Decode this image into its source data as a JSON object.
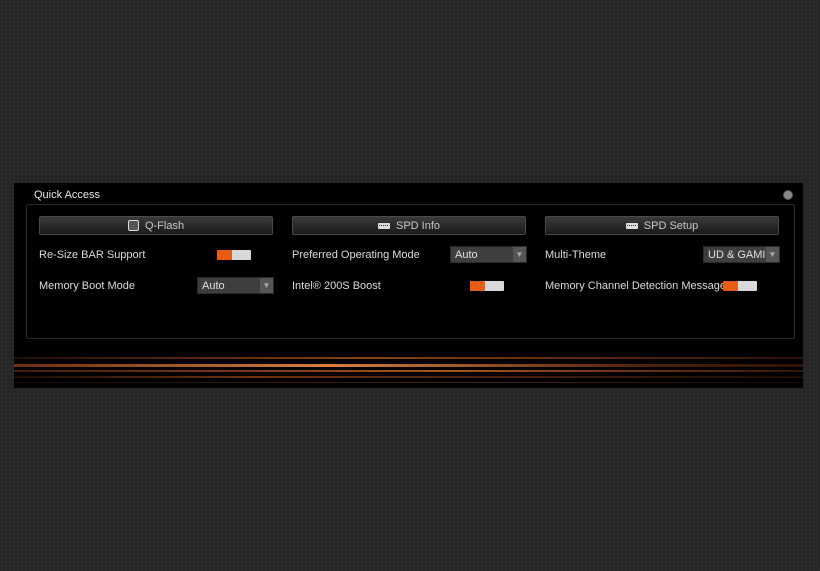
{
  "panel": {
    "title": "Quick Access",
    "accent_color": "#e85d14"
  },
  "columns": [
    {
      "header": {
        "label": "Q-Flash",
        "icon": "q-flash-icon"
      },
      "rows": [
        {
          "label": "Re-Size BAR Support",
          "control": "toggle",
          "state": "on"
        },
        {
          "label": "Memory Boot Mode",
          "control": "select",
          "value": "Auto"
        }
      ]
    },
    {
      "header": {
        "label": "SPD Info",
        "icon": "memory-module-icon"
      },
      "rows": [
        {
          "label": "Preferred Operating Mode",
          "control": "select",
          "value": "Auto"
        },
        {
          "label": "Intel® 200S Boost",
          "control": "toggle",
          "state": "on"
        }
      ]
    },
    {
      "header": {
        "label": "SPD Setup",
        "icon": "memory-module-icon"
      },
      "rows": [
        {
          "label": "Multi-Theme",
          "control": "select",
          "value": "UD & GAMIN"
        },
        {
          "label": "Memory Channel Detection Message",
          "control": "toggle",
          "state": "on"
        }
      ]
    }
  ]
}
